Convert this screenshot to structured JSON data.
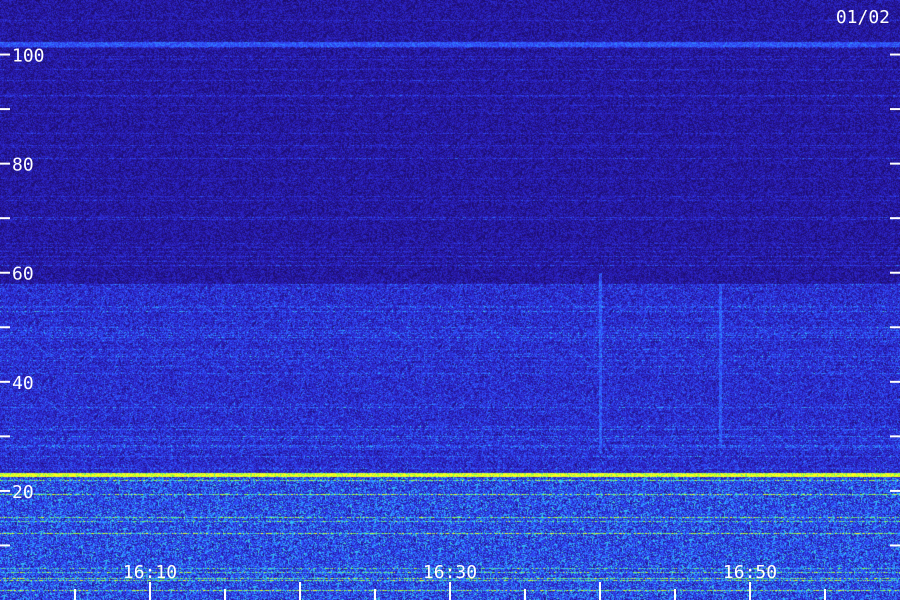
{
  "chart_data": {
    "type": "heatmap",
    "title": "",
    "xlabel": "",
    "ylabel": "",
    "date_label": "01/02",
    "x_range": [
      "16:00",
      "17:00"
    ],
    "x_ticks": [
      "16:10",
      "16:30",
      "16:50"
    ],
    "x_tick_minutes": [
      10,
      30,
      50
    ],
    "x_minor_tick_step_minutes": 5,
    "ylim": [
      0,
      110
    ],
    "y_ticks": [
      20,
      40,
      60,
      80,
      100
    ],
    "y_minor_tick_step": 10,
    "grid": false,
    "colormap": [
      "#000000",
      "#1a0a5e",
      "#2a1cb8",
      "#3050ff",
      "#30c8ff",
      "#80ff40",
      "#ffff20"
    ],
    "features": [
      {
        "kind": "horizontal-band",
        "y": 102,
        "intensity": 0.55
      },
      {
        "kind": "horizontal-band",
        "y": 23,
        "intensity": 0.95
      },
      {
        "kind": "low-band-activity",
        "y_range": [
          0,
          23
        ],
        "intensity": 0.7
      },
      {
        "kind": "elevated-noise",
        "y_range": [
          23,
          58
        ],
        "intensity": 0.35
      },
      {
        "kind": "vertical-streak",
        "x_minute": 40,
        "y_range": [
          27,
          60
        ],
        "intensity": 0.4
      },
      {
        "kind": "vertical-streak",
        "x_minute": 48,
        "y_range": [
          28,
          58
        ],
        "intensity": 0.4
      }
    ]
  }
}
